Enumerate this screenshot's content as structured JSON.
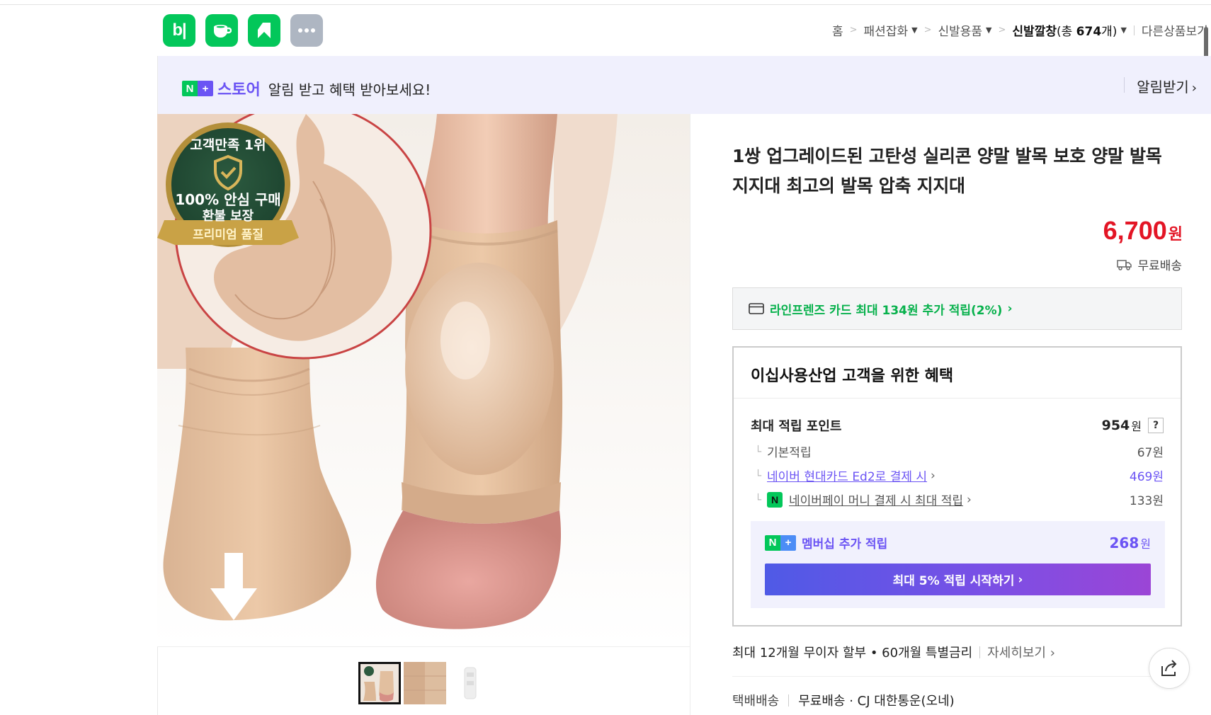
{
  "header": {
    "apps": [
      {
        "name": "blog-app",
        "label": "b|"
      },
      {
        "name": "cafe-app"
      },
      {
        "name": "bookmark-app"
      },
      {
        "name": "more-app"
      }
    ],
    "breadcrumb": {
      "home": "홈",
      "cat1": "패션잡화",
      "cat2": "신발용품",
      "cat3": "신발깔창",
      "count_prefix": "(총 ",
      "count": "674",
      "count_suffix": "개)",
      "other": "다른상품보기"
    }
  },
  "banner": {
    "n": "N",
    "plus": "+",
    "store": "스토어",
    "text": "알림 받고 혜택 받아보세요!",
    "alarm": "알림받기"
  },
  "product": {
    "title": "1쌍 업그레이드된 고탄성 실리콘 양말 발목 보호 양말 발목 지지대 최고의 발목 압축 지지대",
    "price": "6,700",
    "price_unit": "원",
    "shipping": "무료배송",
    "badge": {
      "line1": "고객만족 1위",
      "line2": "100% 안심 구매",
      "line3": "환불 보장",
      "ribbon": "프리미엄 품질"
    }
  },
  "card_offer": {
    "text": "라인프렌즈 카드 최대 134원 추가 적립(2%)"
  },
  "benefit": {
    "heading": "이십사용산업 고객을 위한 혜택",
    "max_points_label": "최대 적립 포인트",
    "max_points": "954",
    "unit": "원",
    "help": "?",
    "basic_label": "기본적립",
    "basic_value": "67원",
    "hyundai_label": "네이버 현대카드 Ed2로 결제 시",
    "hyundai_value": "469원",
    "npay_label": "네이버페이 머니 결제 시 최대 적립",
    "npay_value": "133원",
    "member_label": "멤버십 추가 적립",
    "member_value": "268",
    "member_button": "최대 5% 적립 시작하기"
  },
  "installment": {
    "text": "최대 12개월 무이자 할부 • 60개월 특별금리",
    "more": "자세히보기"
  },
  "delivery": {
    "label": "택배배송",
    "text": "무료배송 · CJ 대한통운(오네)"
  },
  "colors": {
    "naver_green": "#03c75a",
    "store_purple": "#6b54f4",
    "price_red": "#e31525"
  }
}
